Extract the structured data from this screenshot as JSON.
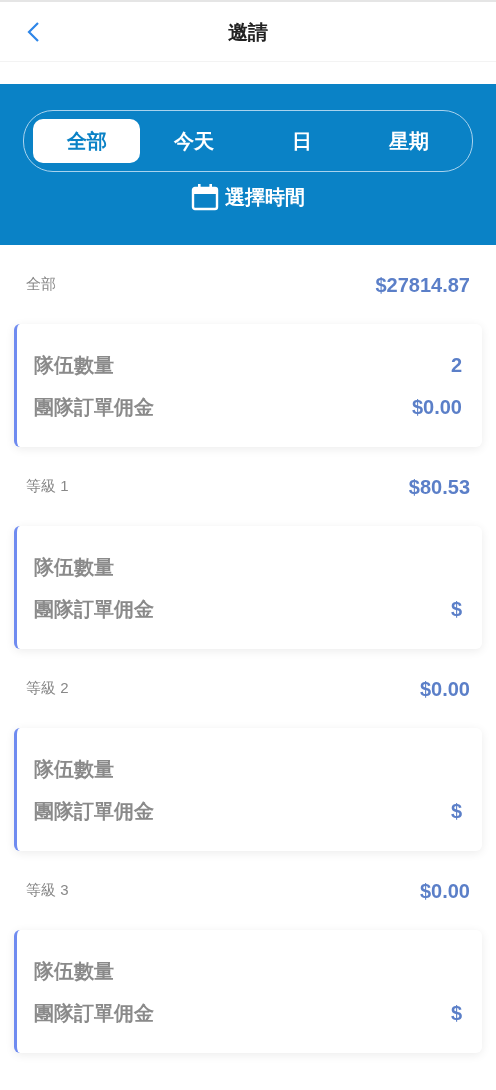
{
  "header": {
    "title": "邀請"
  },
  "filter": {
    "tabs": [
      {
        "label": "全部",
        "selected": true
      },
      {
        "label": "今天",
        "selected": false
      },
      {
        "label": "日",
        "selected": false
      },
      {
        "label": "星期",
        "selected": false
      }
    ],
    "pick_time": "選擇時間"
  },
  "sections": [
    {
      "label": "全部",
      "total": "$27814.87",
      "rows": [
        {
          "label": "隊伍數量",
          "value": "2"
        },
        {
          "label": "團隊訂單佣金",
          "value": "$0.00"
        }
      ]
    },
    {
      "label": "等級 1",
      "total": "$80.53",
      "rows": [
        {
          "label": "隊伍數量"
        },
        {
          "label": "團隊訂單佣金",
          "value": "$"
        }
      ]
    },
    {
      "label": "等級 2",
      "total": "$0.00",
      "rows": [
        {
          "label": "隊伍數量"
        },
        {
          "label": "團隊訂單佣金",
          "value": "$"
        }
      ]
    },
    {
      "label": "等級 3",
      "total": "$0.00",
      "rows": [
        {
          "label": "隊伍數量"
        },
        {
          "label": "團隊訂單佣金",
          "value": "$"
        }
      ]
    }
  ]
}
